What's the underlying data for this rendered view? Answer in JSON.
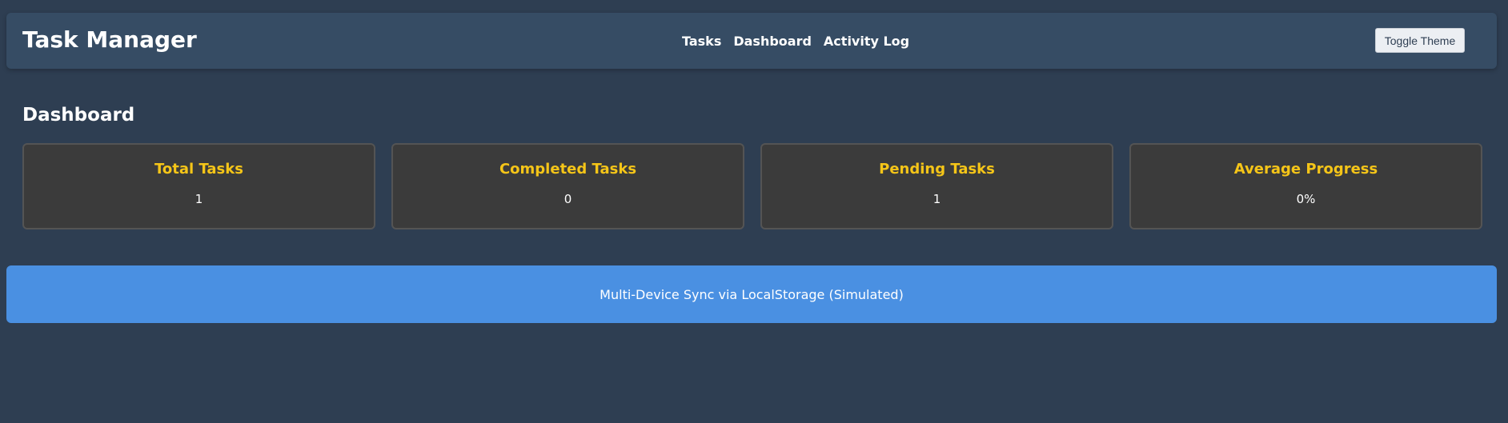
{
  "header": {
    "title": "Task Manager",
    "nav": [
      "Tasks",
      "Dashboard",
      "Activity Log"
    ],
    "toggle_label": "Toggle Theme"
  },
  "dashboard": {
    "title": "Dashboard",
    "stats": [
      {
        "label": "Total Tasks",
        "value": "1"
      },
      {
        "label": "Completed Tasks",
        "value": "0"
      },
      {
        "label": "Pending Tasks",
        "value": "1"
      },
      {
        "label": "Average Progress",
        "value": "0%"
      }
    ]
  },
  "sync_banner": {
    "text": "Multi-Device Sync via LocalStorage (Simulated)"
  },
  "colors": {
    "background": "#2e3e52",
    "header": "#364c64",
    "card": "#3b3b3b",
    "stat_label": "#f5c518",
    "banner": "#4a90e2"
  }
}
